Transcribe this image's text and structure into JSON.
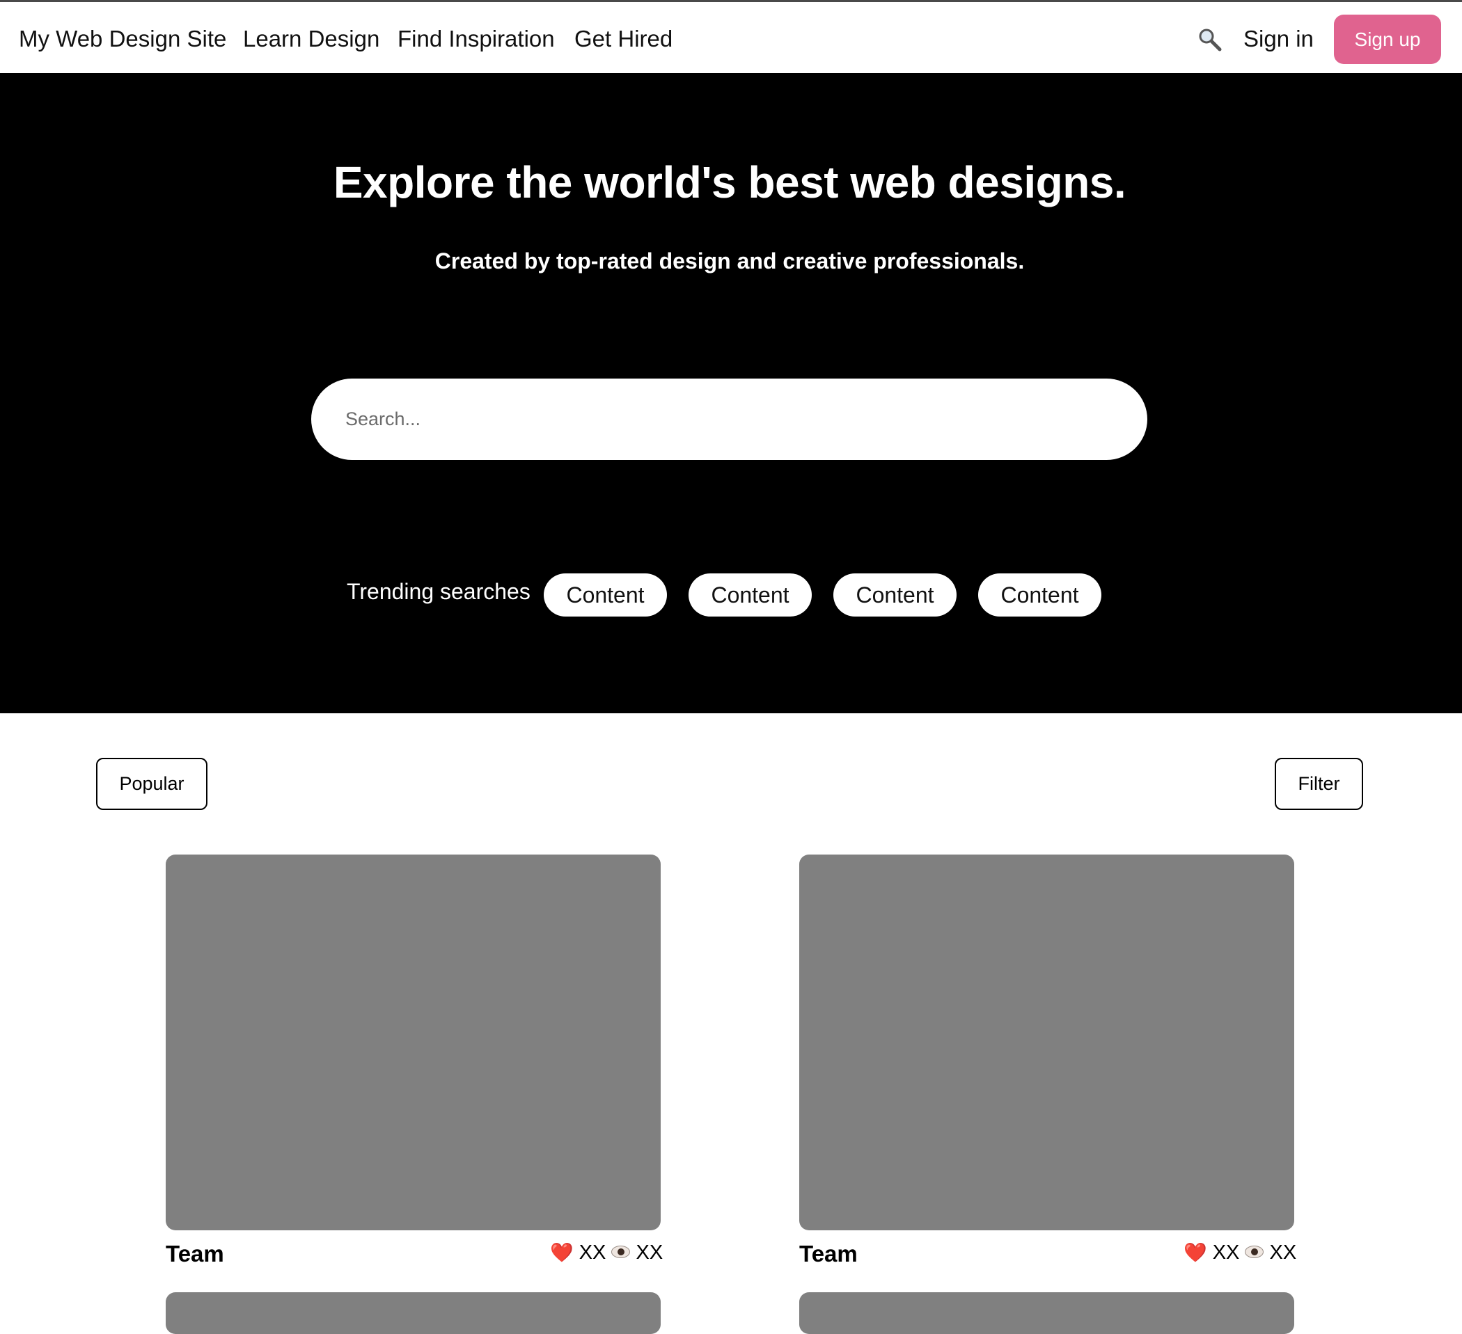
{
  "header": {
    "site_name": "My Web Design Site",
    "nav": [
      "Learn Design",
      "Find Inspiration",
      "Get Hired"
    ],
    "search_icon": "search-icon",
    "sign_in": "Sign in",
    "sign_up": "Sign up",
    "accent_color": "#e0638f"
  },
  "hero": {
    "title": "Explore the world's best web designs.",
    "subtitle": "Created by top-rated design and creative professionals.",
    "search_placeholder": "Search...",
    "trending_label": "Trending searches",
    "trending": [
      "Content",
      "Content",
      "Content",
      "Content"
    ]
  },
  "toolbar": {
    "sort_label": "Popular",
    "filter_label": "Filter"
  },
  "cards": [
    {
      "title": "Team",
      "likes": "XX",
      "views": "XX"
    },
    {
      "title": "Team",
      "likes": "XX",
      "views": "XX"
    },
    {
      "title": "",
      "likes": "",
      "views": ""
    },
    {
      "title": "",
      "likes": "",
      "views": ""
    }
  ]
}
